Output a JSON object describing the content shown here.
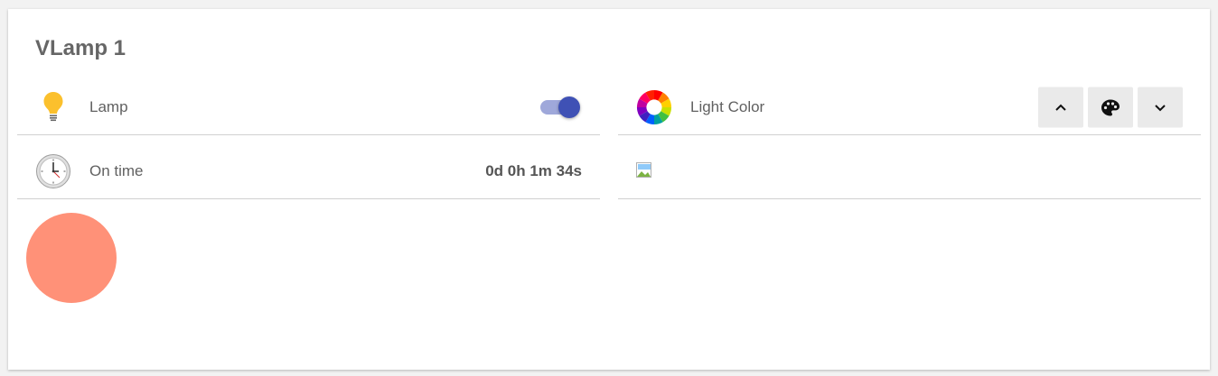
{
  "card": {
    "title": "VLamp 1"
  },
  "lamp": {
    "label": "Lamp",
    "icon": "lightbulb-icon",
    "switch_on": true
  },
  "on_time": {
    "label": "On time",
    "icon": "clock-icon",
    "value": "0d 0h 1m 34s"
  },
  "light_color": {
    "label": "Light Color",
    "icon": "color-wheel-icon",
    "buttons": [
      "chevron-up-icon",
      "palette-icon",
      "chevron-down-icon"
    ]
  },
  "color_preview": {
    "color": "#ff9178"
  },
  "colors": {
    "accent": "#3f51b5",
    "accent_light": "#9fa8da",
    "bulb": "#fbc02d"
  }
}
